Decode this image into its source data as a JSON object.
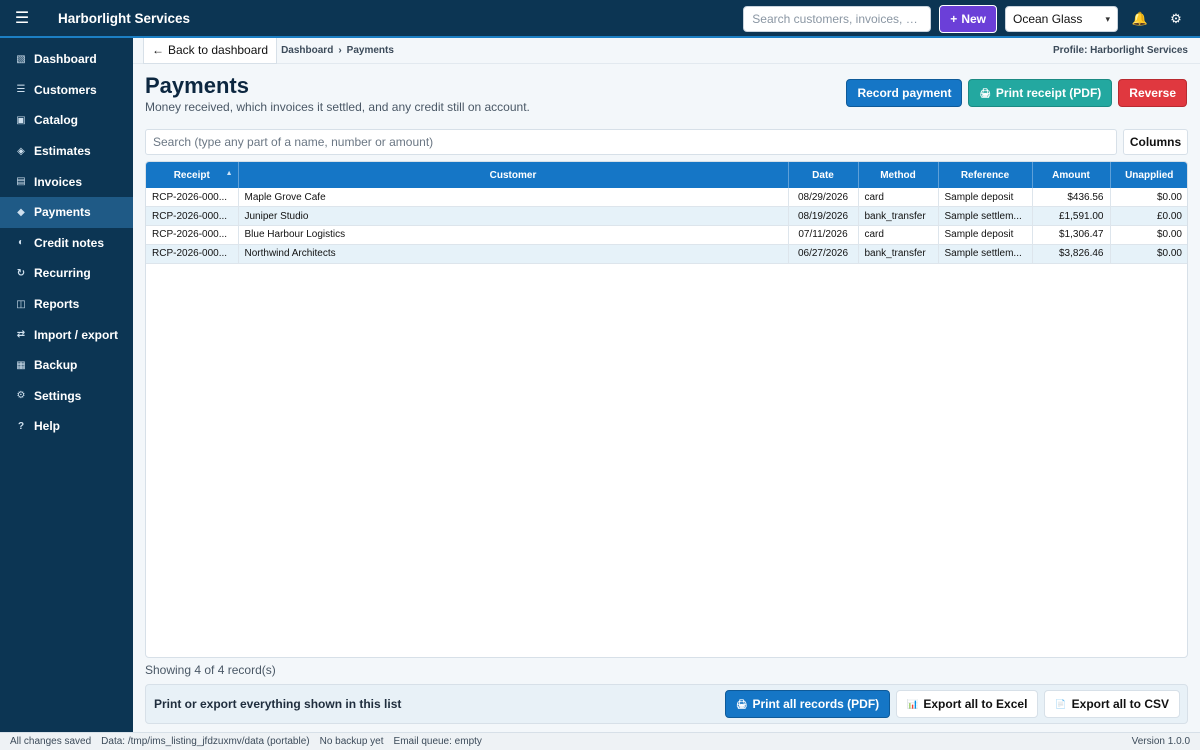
{
  "app": {
    "title": "Harborlight Services"
  },
  "topbar": {
    "search_placeholder": "Search customers, invoices, pa...",
    "new_label": "New",
    "theme_value": "Ocean Glass"
  },
  "sidebar": {
    "items": [
      {
        "label": "Dashboard",
        "icon": "▧"
      },
      {
        "label": "Customers",
        "icon": "☰"
      },
      {
        "label": "Catalog",
        "icon": "▣"
      },
      {
        "label": "Estimates",
        "icon": "◈"
      },
      {
        "label": "Invoices",
        "icon": "▤"
      },
      {
        "label": "Payments",
        "icon": "◆"
      },
      {
        "label": "Credit notes",
        "icon": "◐"
      },
      {
        "label": "Recurring",
        "icon": "↻"
      },
      {
        "label": "Reports",
        "icon": "◫"
      },
      {
        "label": "Import / export",
        "icon": "⇄"
      },
      {
        "label": "Backup",
        "icon": "▦"
      },
      {
        "label": "Settings",
        "icon": "⚙"
      },
      {
        "label": "Help",
        "icon": "?"
      }
    ],
    "active_index": 5
  },
  "crumb": {
    "back_label": "Back to dashboard",
    "items": [
      "Dashboard",
      "Payments"
    ],
    "profile": "Profile: Harborlight Services"
  },
  "page": {
    "title": "Payments",
    "subtitle": "Money received, which invoices it settled, and any credit still on account.",
    "record_label": "Record payment",
    "print_label": "Print receipt (PDF)",
    "reverse_label": "Reverse"
  },
  "list": {
    "search_placeholder": "Search  (type any part of a name, number or amount)",
    "columns_label": "Columns",
    "headers": [
      "Receipt",
      "Customer",
      "Date",
      "Method",
      "Reference",
      "Amount",
      "Unapplied"
    ],
    "rows": [
      [
        "RCP-2026-000...",
        "Maple Grove Cafe",
        "08/29/2026",
        "card",
        "Sample deposit",
        "$436.56",
        "$0.00"
      ],
      [
        "RCP-2026-000...",
        "Juniper Studio",
        "08/19/2026",
        "bank_transfer",
        "Sample settlem...",
        "£1,591.00",
        "£0.00"
      ],
      [
        "RCP-2026-000...",
        "Blue Harbour Logistics",
        "07/11/2026",
        "card",
        "Sample deposit",
        "$1,306.47",
        "$0.00"
      ],
      [
        "RCP-2026-000...",
        "Northwind Architects",
        "06/27/2026",
        "bank_transfer",
        "Sample settlem...",
        "$3,826.46",
        "$0.00"
      ]
    ],
    "showing": "Showing 4 of 4 record(s)"
  },
  "export": {
    "label": "Print or export everything shown in this list",
    "print_all": "Print all records (PDF)",
    "excel": "Export all to Excel",
    "csv": "Export all to CSV"
  },
  "status": {
    "saved": "All changes saved",
    "data": "Data: /tmp/ims_listing_jfdzuxmv/data  (portable)",
    "backup": "No backup yet",
    "email": "Email queue: empty",
    "version": "Version 1.0.0"
  }
}
